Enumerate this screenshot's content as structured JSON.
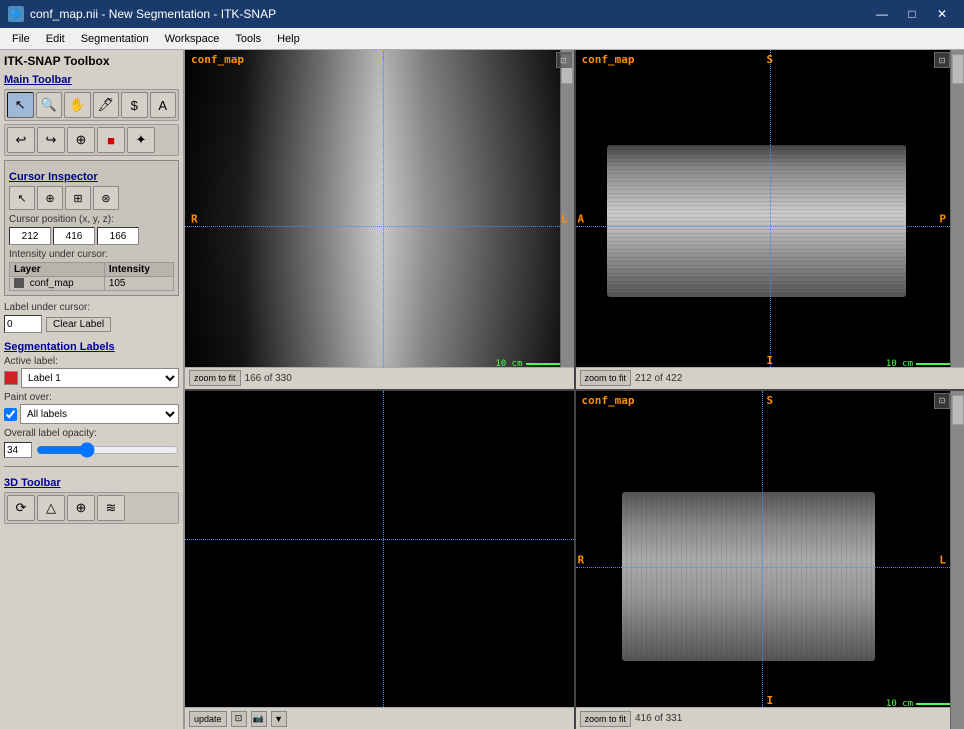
{
  "window": {
    "title": "conf_map.nii - New Segmentation - ITK-SNAP",
    "icon": "🔷"
  },
  "titlebar": {
    "minimize": "—",
    "maximize": "□",
    "close": "✕"
  },
  "menu": {
    "items": [
      "File",
      "Edit",
      "Segmentation",
      "Workspace",
      "Tools",
      "Help"
    ]
  },
  "toolbox": {
    "title": "ITK-SNAP Toolbox",
    "main_toolbar_label": "Main Toolbar",
    "cursor_inspector_label": "Cursor Inspector",
    "cursor_pos_label": "Cursor position (x, y, z):",
    "cursor_x": "212",
    "cursor_y": "416",
    "cursor_z": "166",
    "intensity_label": "Intensity under cursor:",
    "intensity_col1": "Layer",
    "intensity_col2": "Intensity",
    "intensity_layer": "conf_map",
    "intensity_value": "105",
    "label_under_cursor": "Label under cursor:",
    "label_value": "0",
    "clear_label_btn": "Clear Label",
    "seg_labels_label": "Segmentation Labels",
    "active_label": "Active label:",
    "label1_name": "Label 1",
    "paint_over_label": "Paint over:",
    "paint_over_value": "All labels",
    "opacity_label": "Overall label opacity:",
    "opacity_value": "34",
    "toolbar_3d_label": "3D Toolbar"
  },
  "viewports": {
    "vp1": {
      "label": "conf_map",
      "left_marker": "R",
      "right_marker": "L",
      "scale": "10 cm",
      "slice_info": "166 of 330"
    },
    "vp2": {
      "label": "conf_map",
      "top_marker": "S",
      "left_marker": "A",
      "right_marker": "P",
      "bottom_marker": "I",
      "scale": "10 cm",
      "slice_info": "212 of 422"
    },
    "vp3": {
      "update_btn": "update",
      "slice_info": ""
    },
    "vp4": {
      "label": "conf_map",
      "top_marker": "S",
      "left_marker": "R",
      "right_marker": "L",
      "bottom_marker": "I",
      "scale": "10 cm",
      "slice_info": "416 of 331"
    }
  },
  "statusbar": {
    "vp1_zoom": "zoom to fit",
    "vp2_zoom": "zoom to fit",
    "vp4_zoom": "zoom to fit"
  }
}
